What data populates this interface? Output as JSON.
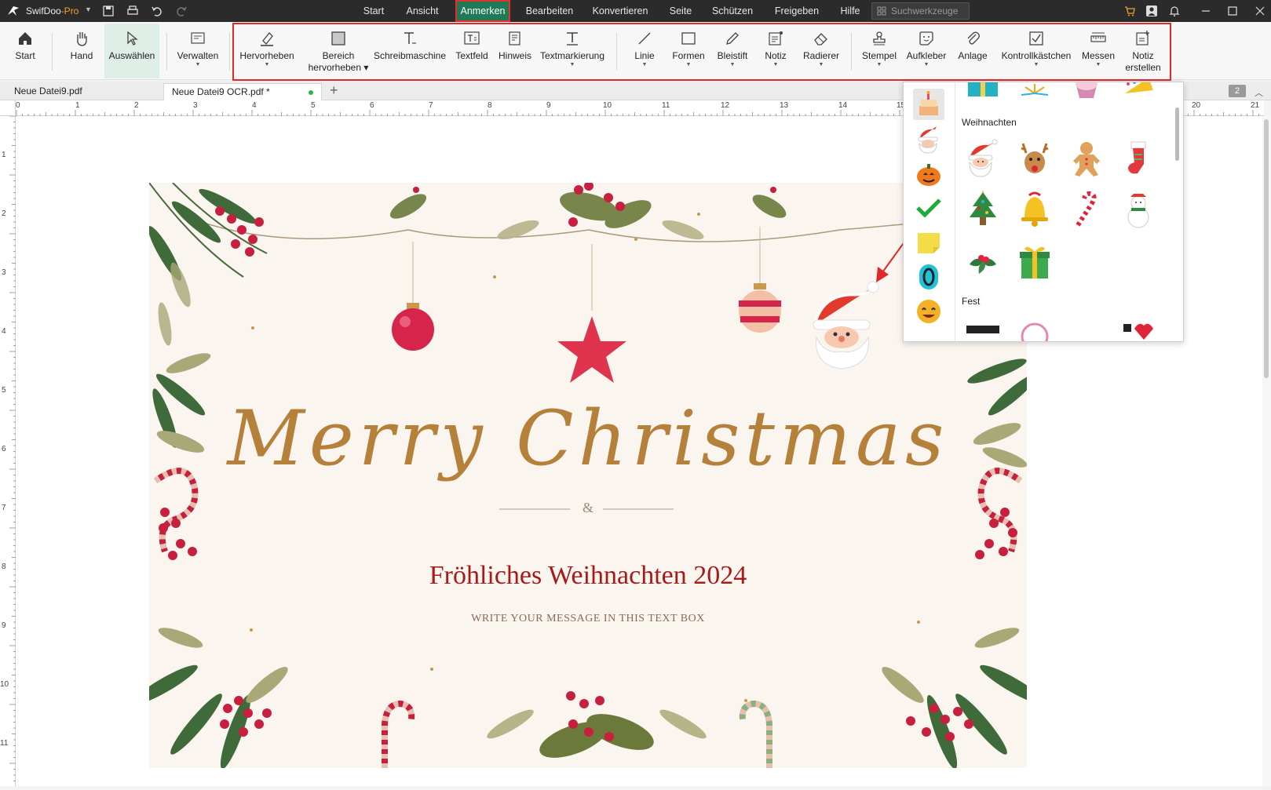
{
  "app": {
    "name": "SwifDoo",
    "edition": "-Pro"
  },
  "menu": [
    "Start",
    "Ansicht",
    "Anmerken",
    "Bearbeiten",
    "Konvertieren",
    "Seite",
    "Schützen",
    "Freigeben",
    "Hilfe"
  ],
  "search": {
    "placeholder": "Suchwerkzeuge"
  },
  "ribbon": {
    "start": "Start",
    "hand": "Hand",
    "select": "Auswählen",
    "manage": "Verwalten",
    "highlight": "Hervorheben",
    "area1": "Bereich",
    "area2": "hervorheben",
    "typewriter": "Schreibmaschine",
    "textbox": "Textfeld",
    "note_hint": "Hinweis",
    "textmark": "Textmarkierung",
    "line": "Linie",
    "shapes": "Formen",
    "pencil": "Bleistift",
    "note": "Notiz",
    "eraser": "Radierer",
    "stamp": "Stempel",
    "sticker": "Aufkleber",
    "attachment": "Anlage",
    "checkbox": "Kontrollkästchen",
    "measure": "Messen",
    "create1": "Notiz",
    "create2": "erstellen"
  },
  "tabs": [
    {
      "label": "Neue Datei9.pdf"
    },
    {
      "label": "Neue Datei9 OCR.pdf *"
    }
  ],
  "page_indicator": "2",
  "ruler": {
    "h": [
      "0",
      "1",
      "2",
      "3",
      "4",
      "5",
      "6",
      "7",
      "8",
      "9",
      "10",
      "11",
      "12",
      "13",
      "14",
      "15",
      "20",
      "21"
    ],
    "v": [
      "1",
      "2",
      "3",
      "4",
      "5",
      "6",
      "7",
      "8",
      "9",
      "10",
      "11"
    ]
  },
  "card": {
    "title": "Merry Christmas",
    "amp": "&",
    "greeting": "Fröhliches Weihnachten 2024",
    "message": "WRITE YOUR MESSAGE IN THIS TEXT BOX"
  },
  "sticker_panel": {
    "section1": "Weihnachten",
    "section2": "Fest",
    "categories": [
      "birthday-cake",
      "santa",
      "pumpkin",
      "checkmark",
      "sticky-note",
      "number-zero",
      "smiley"
    ],
    "stickers": [
      "santa",
      "reindeer",
      "gingerbread",
      "stocking",
      "christmas-tree",
      "bell",
      "candy-cane",
      "snowman",
      "holly",
      "gift"
    ]
  },
  "colors": {
    "accent": "#1f7a55",
    "highlight_box": "#e02a2a",
    "greeting": "#a61a1a",
    "gold": "#b5803a"
  }
}
